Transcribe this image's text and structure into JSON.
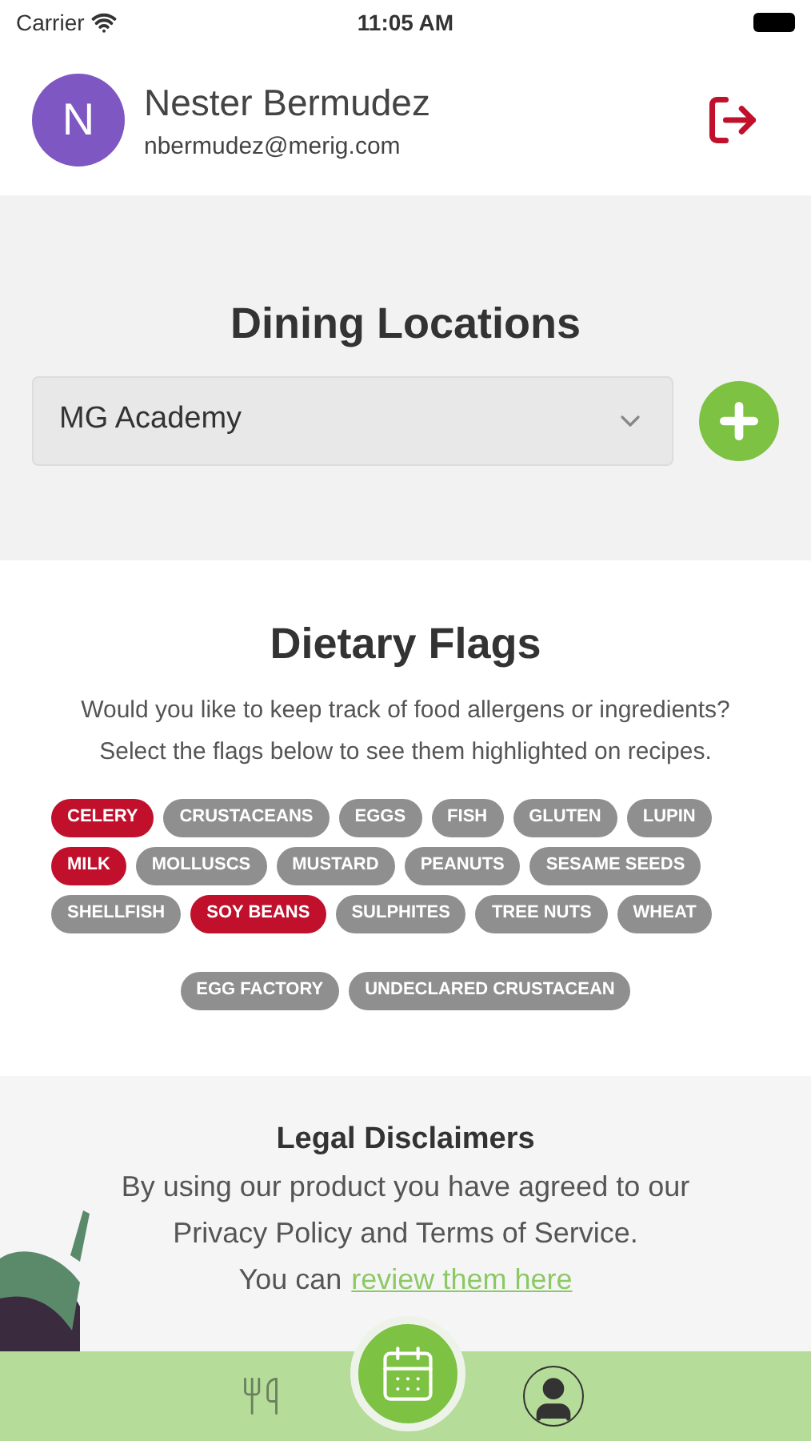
{
  "status_bar": {
    "carrier": "Carrier",
    "time": "11:05 AM"
  },
  "user": {
    "initial": "N",
    "name": "Nester Bermudez",
    "email": "nbermudez@merig.com"
  },
  "dining": {
    "title": "Dining Locations",
    "selected_location": "MG Academy"
  },
  "dietary": {
    "title": "Dietary Flags",
    "description": "Would you like to keep track of food allergens or ingredients? Select the flags below to see them highlighted on recipes.",
    "flags": [
      {
        "label": "CELERY",
        "selected": true
      },
      {
        "label": "CRUSTACEANS",
        "selected": false
      },
      {
        "label": "EGGS",
        "selected": false
      },
      {
        "label": "FISH",
        "selected": false
      },
      {
        "label": "GLUTEN",
        "selected": false
      },
      {
        "label": "LUPIN",
        "selected": false
      },
      {
        "label": "MILK",
        "selected": true
      },
      {
        "label": "MOLLUSCS",
        "selected": false
      },
      {
        "label": "MUSTARD",
        "selected": false
      },
      {
        "label": "PEANUTS",
        "selected": false
      },
      {
        "label": "SESAME SEEDS",
        "selected": false
      },
      {
        "label": "SHELLFISH",
        "selected": false
      },
      {
        "label": "SOY BEANS",
        "selected": true
      },
      {
        "label": "SULPHITES",
        "selected": false
      },
      {
        "label": "TREE NUTS",
        "selected": false
      },
      {
        "label": "WHEAT",
        "selected": false
      }
    ],
    "custom_flags": [
      {
        "label": "EGG FACTORY",
        "selected": false
      },
      {
        "label": "UNDECLARED CRUSTACEAN",
        "selected": false
      }
    ]
  },
  "legal": {
    "title": "Legal Disclaimers",
    "text": "By using our product you have agreed to our Privacy Policy and Terms of Service.",
    "link_prefix": "You can",
    "link": "review them here"
  },
  "tab_bar": {
    "tabs": [
      {
        "kind": "dining",
        "selected": false
      },
      {
        "kind": "calendar",
        "selected": true
      },
      {
        "kind": "profile",
        "selected": false
      }
    ]
  }
}
